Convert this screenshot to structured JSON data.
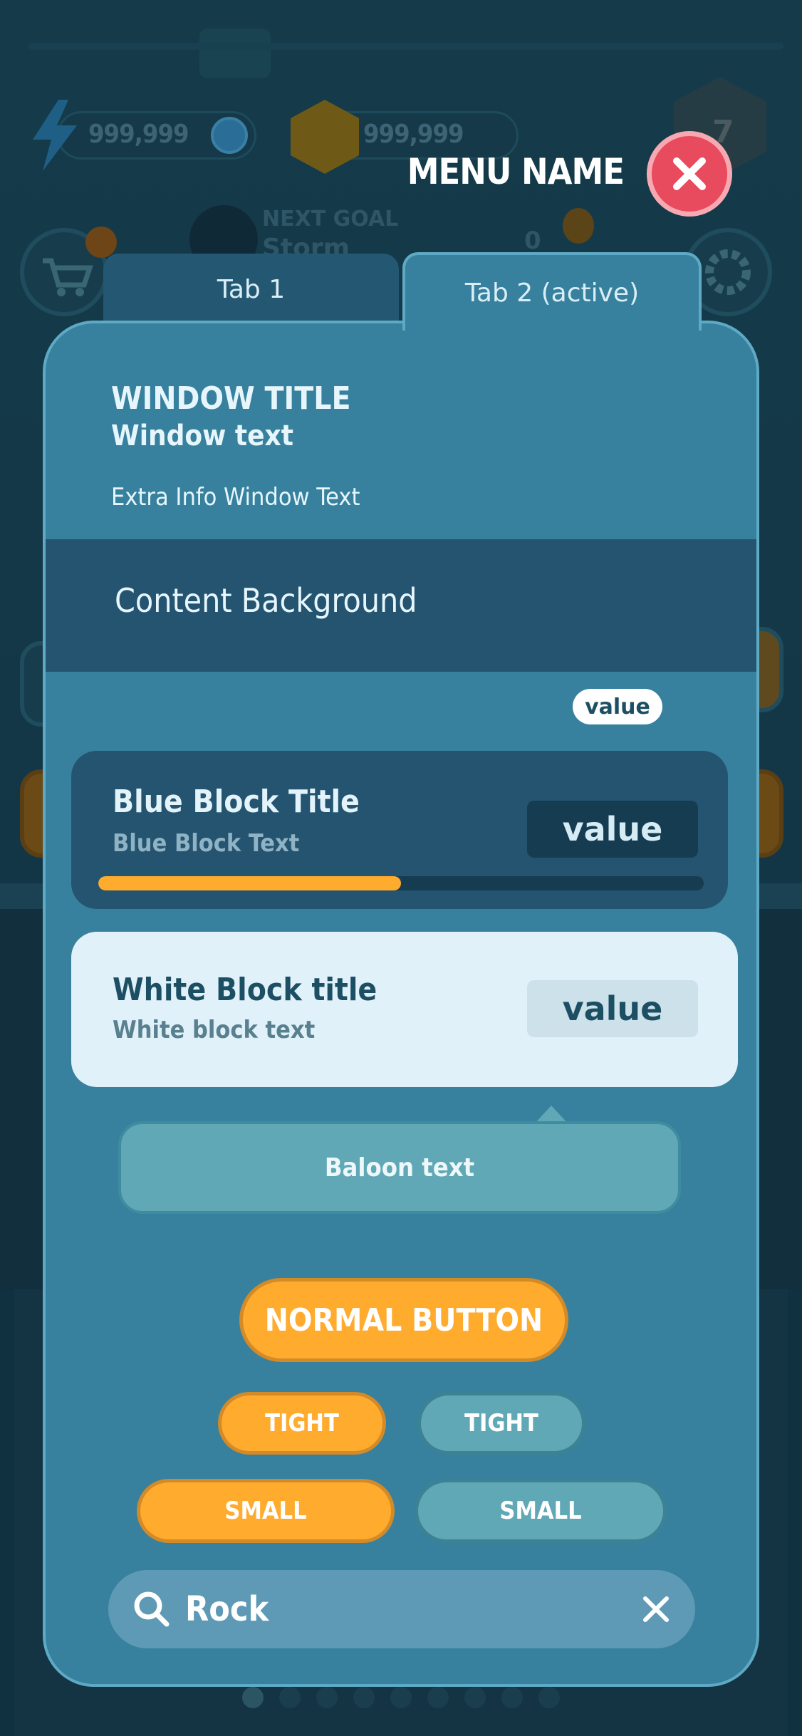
{
  "background": {
    "energy_value": "999,999",
    "coins_value": "999,999",
    "level_badge": "7",
    "next_goal_label": "NEXT GOAL",
    "next_goal_name": "Storm",
    "bulb_count": "0"
  },
  "menu": {
    "name": "MENU NAME",
    "close_icon": "close-x-icon"
  },
  "tabs": [
    {
      "label": "Tab 1",
      "active": false
    },
    {
      "label": "Tab 2 (active)",
      "active": true
    }
  ],
  "window": {
    "title": "WINDOW TITLE",
    "text": "Window text",
    "extra_info": "Extra Info Window Text",
    "content_background_label": "Content Background",
    "value_chip": "value"
  },
  "blue_block": {
    "title": "Blue Block Title",
    "text": "Blue Block Text",
    "value": "value",
    "progress": 0.5
  },
  "white_block": {
    "title": "White Block title",
    "text": "White block text",
    "value": "value"
  },
  "balloon": {
    "text": "Baloon text"
  },
  "buttons": {
    "normal": "NORMAL BUTTON",
    "tight_orange": "TIGHT",
    "tight_teal": "TIGHT",
    "small_orange": "SMALL",
    "small_teal": "SMALL"
  },
  "search": {
    "value": "Rock",
    "icon": "search-icon",
    "clear_icon": "clear-icon"
  },
  "pagination": {
    "count": 9,
    "active_index": 0
  },
  "colors": {
    "window": "#37819e",
    "window_border": "#5ea9c4",
    "content_bg": "#245470",
    "accent_orange": "#ffab2e",
    "teal_button": "#61a8b6",
    "close_red": "#e84a5e",
    "white_block": "#e1f1fa"
  }
}
